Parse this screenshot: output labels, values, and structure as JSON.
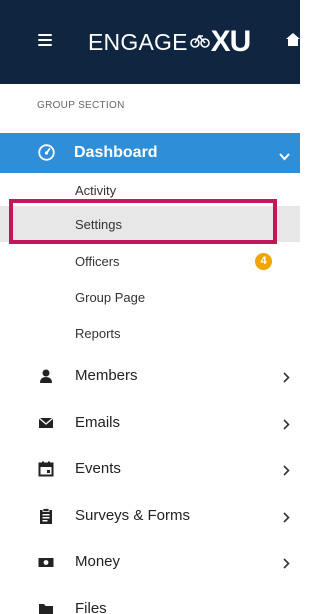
{
  "header": {
    "brand_text": "ENGAGE",
    "brand_suffix": "XU"
  },
  "sidebar": {
    "section_label": "GROUP SECTION",
    "dashboard": {
      "label": "Dashboard",
      "subitems": [
        {
          "label": "Activity"
        },
        {
          "label": "Settings",
          "highlighted": true
        },
        {
          "label": "Officers",
          "badge": "4"
        },
        {
          "label": "Group Page"
        },
        {
          "label": "Reports"
        }
      ]
    },
    "items": [
      {
        "label": "Members",
        "icon": "person-icon",
        "has_submenu": true
      },
      {
        "label": "Emails",
        "icon": "envelope-icon",
        "has_submenu": true
      },
      {
        "label": "Events",
        "icon": "calendar-icon",
        "has_submenu": true
      },
      {
        "label": "Surveys & Forms",
        "icon": "clipboard-icon",
        "has_submenu": true
      },
      {
        "label": "Money",
        "icon": "money-icon",
        "has_submenu": true
      },
      {
        "label": "Files",
        "icon": "folder-icon",
        "has_submenu": false
      }
    ]
  },
  "colors": {
    "topbar": "#0f2540",
    "active_item": "#2f8ed8",
    "highlight_border": "#c2185b",
    "badge": "#f0a500",
    "selected_row": "#e7e7e7"
  }
}
